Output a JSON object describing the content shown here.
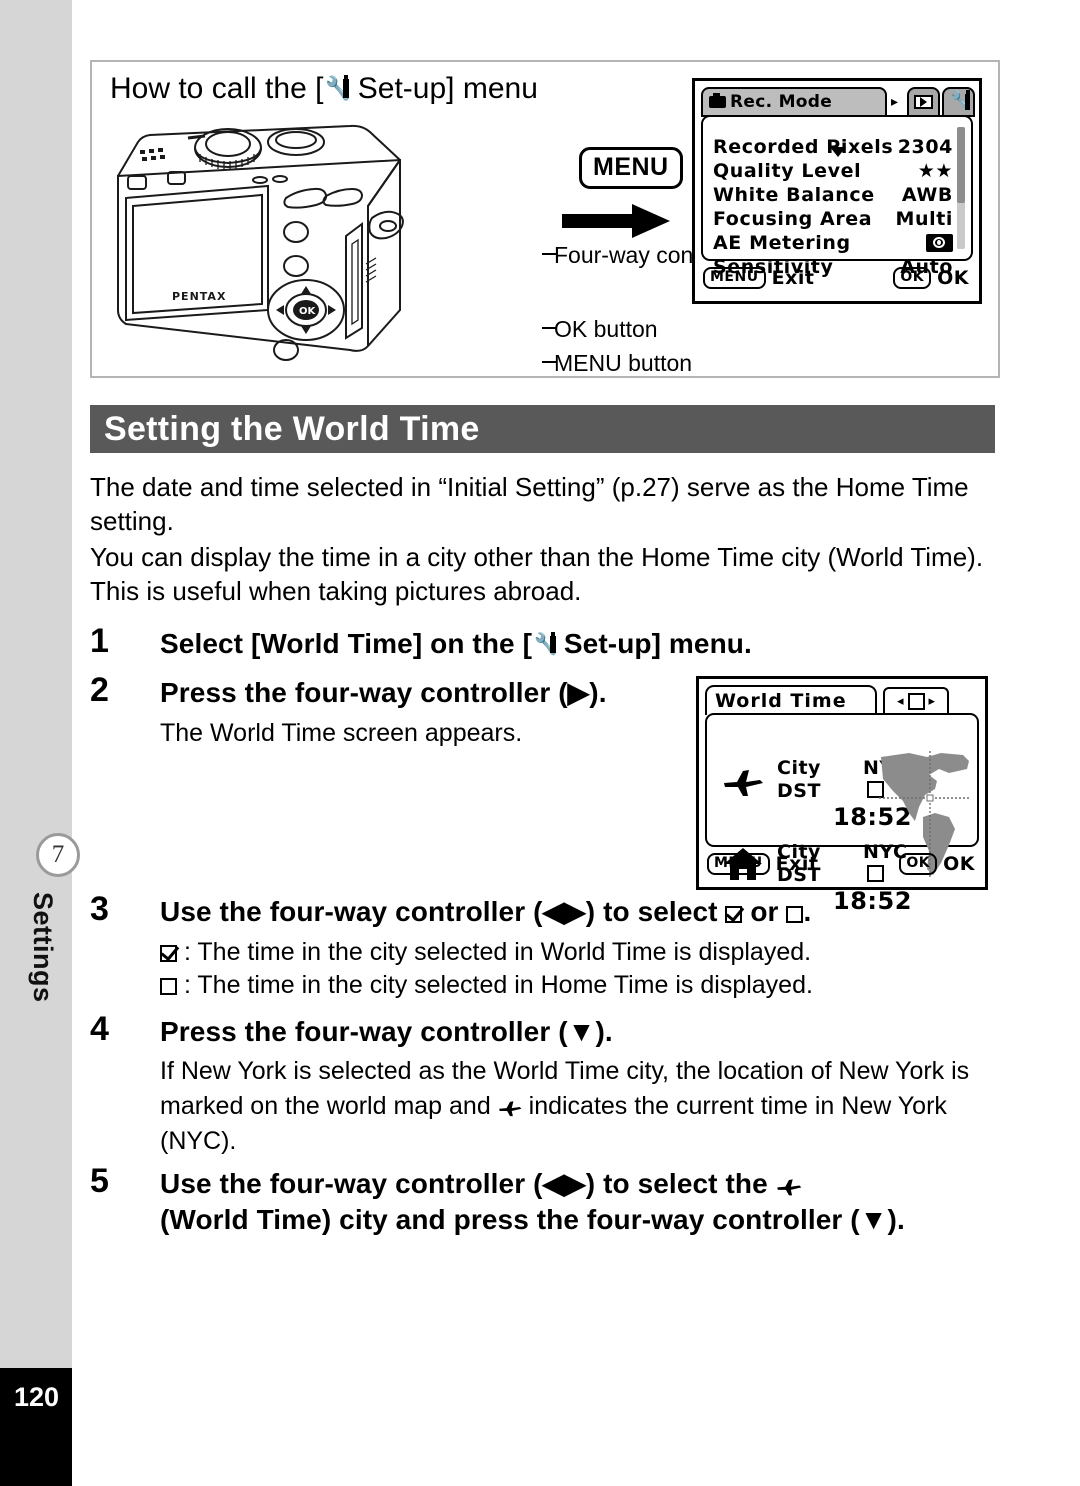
{
  "page": {
    "number": "120",
    "chapter_badge": "7",
    "chapter_label": "Settings"
  },
  "howto": {
    "title_before": "How to call the [",
    "title_after": " Set-up] menu",
    "setup_icon": "wrench-screwdriver-icon",
    "menu_badge": "MENU",
    "arrow_icon": "arrow-right-icon",
    "callouts": [
      {
        "label": "Four-way controller",
        "name": "callout-four-way-controller"
      },
      {
        "label": "OK button",
        "name": "callout-ok-button"
      },
      {
        "label": "MENU button",
        "name": "callout-menu-button"
      }
    ],
    "camera_brand": "PENTAX"
  },
  "rec_mode_screen": {
    "tab_title": "Rec. Mode",
    "tab_camera_icon": "camera-icon",
    "tab_arrow": "▸",
    "tabs": [
      {
        "name": "tab-playback",
        "icon": "playback-icon"
      },
      {
        "name": "tab-setup",
        "icon": "wrench-screwdriver-icon"
      }
    ],
    "rows": [
      {
        "label": "Recorded Pixels",
        "value": "2304",
        "value_type": "text"
      },
      {
        "label": "Quality Level",
        "value": "★★",
        "value_type": "text"
      },
      {
        "label": "White Balance",
        "value": "AWB",
        "value_type": "text"
      },
      {
        "label": "Focusing Area",
        "value": "Multi",
        "value_type": "text"
      },
      {
        "label": "AE Metering",
        "value": "",
        "value_type": "ae-metering-icon"
      },
      {
        "label": "Sensitivity",
        "value": "Auto",
        "value_type": "text"
      }
    ],
    "footer": {
      "left_key": "MENU",
      "left_label": "Exit",
      "right_key": "OK",
      "right_label": "OK"
    }
  },
  "world_time_screen": {
    "title": "World Time",
    "toggle_left_arrow": "◂",
    "toggle_right_arrow": "▸",
    "toggle_state": "unchecked",
    "blocks": [
      {
        "icon": "airplane-icon",
        "city_label": "City",
        "city_value": "NYC",
        "dst_label": "DST",
        "dst_value": "unchecked",
        "time": "18:52"
      },
      {
        "icon": "home-icon",
        "city_label": "City",
        "city_value": "NYC",
        "dst_label": "DST",
        "dst_value": "unchecked",
        "time": "18:52"
      }
    ],
    "map_icon": "world-map-americas",
    "footer": {
      "left_key": "MENU",
      "left_label": "Exit",
      "right_key": "OK",
      "right_label": "OK"
    }
  },
  "section": {
    "heading": "Setting the World Time",
    "paragraph_1": "The date and time selected in “Initial Setting” (p.27) serve as the Home Time setting.",
    "paragraph_2": "You can display the time in a city other than the Home Time city (World Time). This is useful when taking pictures abroad."
  },
  "steps": [
    {
      "number": "1",
      "head_before": "Select [World Time] on the [",
      "head_after": " Set-up] menu.",
      "has_setup_icon": true
    },
    {
      "number": "2",
      "head": "Press the four-way controller (▶).",
      "body": "The World Time screen appears."
    },
    {
      "number": "3",
      "head_before": "Use the four-way controller (◀▶) to select ",
      "head_mid": " or ",
      "head_after": ".",
      "sub_1": ": The time in the city selected in World Time is displayed.",
      "sub_2": ": The time in the city selected in Home Time is displayed."
    },
    {
      "number": "4",
      "head": "Press the four-way controller (▼).",
      "body_before": "If New York is selected as the World Time city, the location of New York is marked on the world map and ",
      "body_after": " indicates the current time in New York (NYC)."
    },
    {
      "number": "5",
      "head_before": "Use the four-way controller (◀▶) to select the ",
      "head_after": "(World Time) city and press the four-way controller (▼)."
    }
  ],
  "colors": {
    "band": "#595959",
    "rail": "#d6d6d6",
    "page_box": "#000000",
    "map_land": "#8c8c8c"
  }
}
